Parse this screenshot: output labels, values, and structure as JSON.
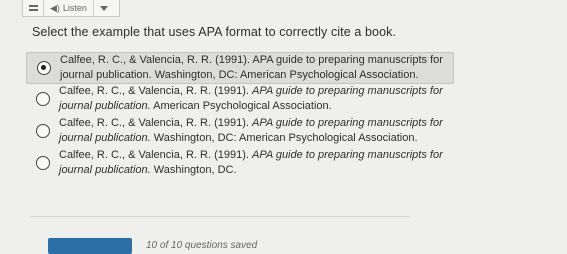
{
  "toolbar": {
    "listen_label": "Listen"
  },
  "question": "Select the example that uses APA format to correctly cite a book.",
  "options": [
    {
      "selected": true,
      "line1_plain": "Calfee, R. C., & Valencia, R. R. (1991). APA guide to preparing manuscripts for",
      "line1_italic": "",
      "line2_italic": "",
      "line2_plain": "journal publication. Washington, DC: American Psychological Association."
    },
    {
      "selected": false,
      "line1_plain": "Calfee, R. C., & Valencia, R. R. (1991). ",
      "line1_italic": "APA guide to preparing manuscripts for",
      "line2_italic": "journal publication.",
      "line2_plain": " American Psychological Association."
    },
    {
      "selected": false,
      "line1_plain": "Calfee, R. C., & Valencia, R. R. (1991). ",
      "line1_italic": "APA guide to preparing manuscripts for",
      "line2_italic": "journal publication.",
      "line2_plain": " Washington, DC: American Psychological Association."
    },
    {
      "selected": false,
      "line1_plain": "Calfee, R. C., & Valencia, R. R. (1991). ",
      "line1_italic": "APA guide to preparing manuscripts for",
      "line2_italic": "journal publication.",
      "line2_plain": " Washington, DC."
    }
  ],
  "footer": {
    "saved_status": "10 of 10 questions saved"
  },
  "colors": {
    "accent": "#2b6fa6",
    "selected_bg": "#dcdcda"
  }
}
